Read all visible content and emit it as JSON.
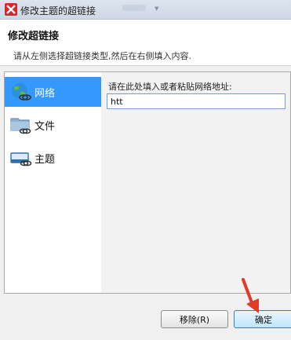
{
  "window": {
    "title": "修改主题的超链接"
  },
  "header": {
    "title": "修改超链接",
    "description": "请从左侧选择超链接类型,然后在右侧填入内容."
  },
  "sidebar": {
    "items": [
      {
        "label": "网络",
        "icon": "globe-link-icon",
        "selected": true
      },
      {
        "label": "文件",
        "icon": "folder-link-icon",
        "selected": false
      },
      {
        "label": "主题",
        "icon": "topic-link-icon",
        "selected": false
      }
    ]
  },
  "content": {
    "field_label": "请在此处填入或者粘贴网络地址:",
    "url_value": "htt"
  },
  "buttons": {
    "remove_label": "移除(R)",
    "ok_label": "确定"
  },
  "colors": {
    "selected_bg": "#3399ff",
    "arrow": "#e03a2a",
    "app_icon": "#d9262b"
  }
}
